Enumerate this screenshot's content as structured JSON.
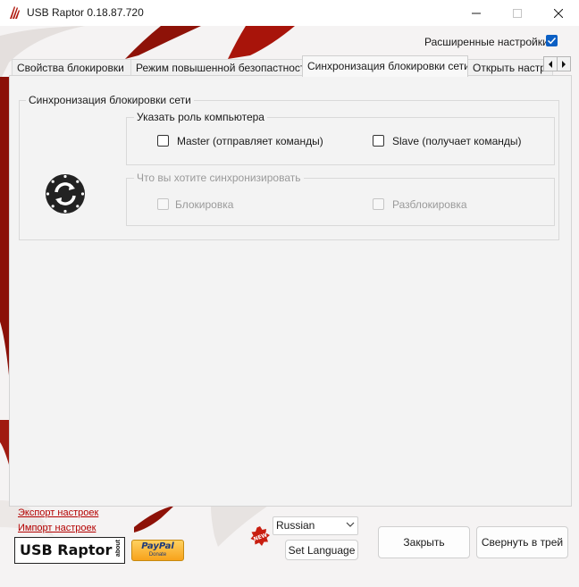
{
  "window": {
    "title": "USB Raptor 0.18.87.720",
    "controls": [
      "minimize-icon",
      "maximize-icon",
      "close-icon"
    ]
  },
  "advanced_settings": {
    "label": "Расширенные настройки",
    "checked": true,
    "accent": "#0b5fc4"
  },
  "tabs": [
    {
      "label": "Свойства блокировки",
      "active": false
    },
    {
      "label": "Режим повышенной безопастности",
      "active": false
    },
    {
      "label": "Синхронизация блокировки сети",
      "active": true
    },
    {
      "label": "Открыть настр",
      "active": false
    }
  ],
  "tab_scroll": {
    "left_icon": "chevron-left-icon",
    "right_icon": "chevron-right-icon"
  },
  "sync_group": {
    "title": "Синхронизация блокировки сети",
    "icon": "sync-icon",
    "role_group": {
      "title": "Указать роль компьютера",
      "options": [
        {
          "label": "Master (отправляет команды)",
          "checked": false
        },
        {
          "label": "Slave (получает команды)",
          "checked": false
        }
      ]
    },
    "what_group": {
      "title": "Что вы хотите синхронизировать",
      "disabled": true,
      "options": [
        {
          "label": "Блокировка",
          "checked": false
        },
        {
          "label": "Разблокировка",
          "checked": false
        }
      ]
    }
  },
  "footer": {
    "export_link": "Экспорт настроек",
    "import_link": "Импорт настроек",
    "logo_text": "USB Raptor",
    "logo_about": "about",
    "paypal_text": "PayPal",
    "paypal_sub": "Donate",
    "new_badge": "NEW",
    "language_value": "Russian",
    "set_language_label": "Set Language",
    "close_label": "Закрыть",
    "tray_label": "Свернуть в трей",
    "link_color": "#b40000"
  }
}
